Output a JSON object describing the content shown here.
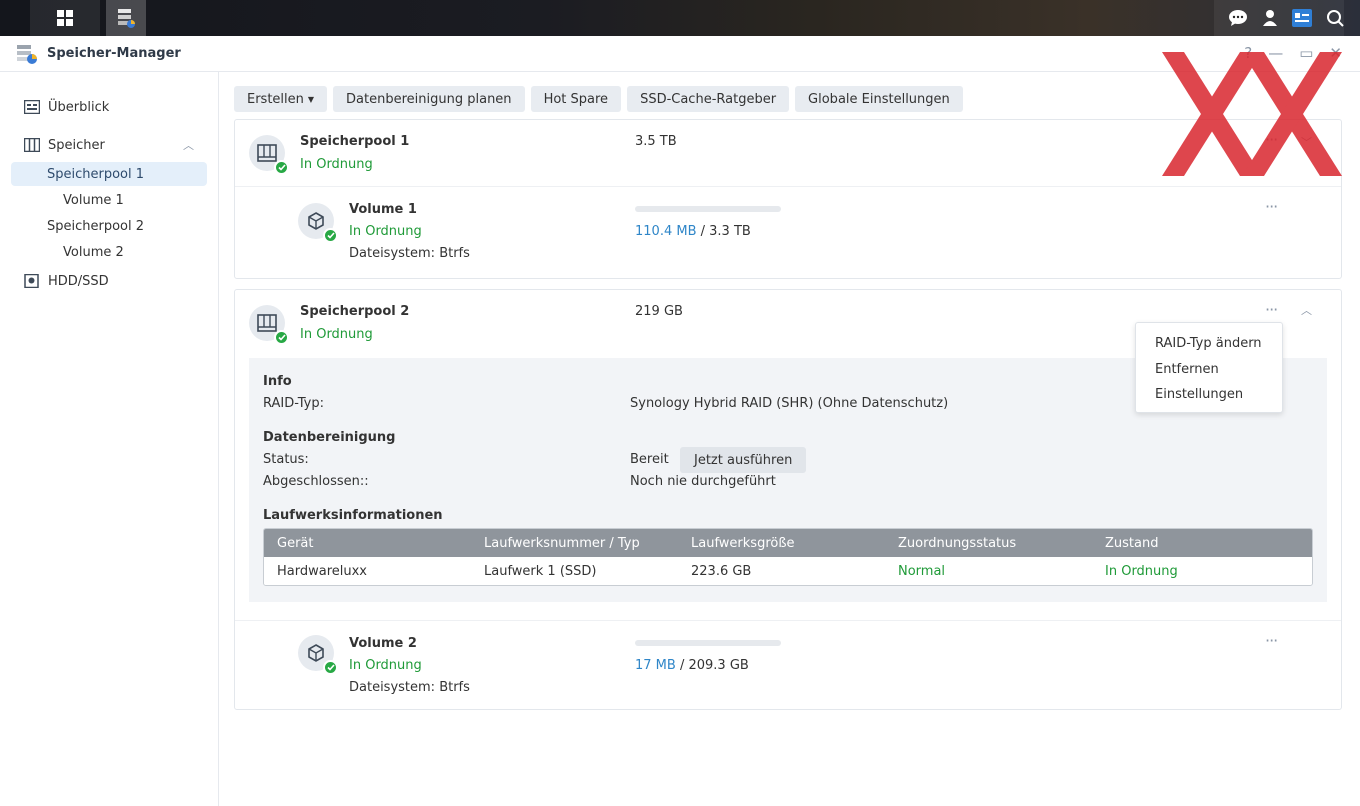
{
  "taskbar": {
    "grid_icon": "grid-icon",
    "app_icon": "storage-manager-icon",
    "right_icons": [
      "chat-icon",
      "user-icon",
      "widget-icon",
      "search-icon"
    ]
  },
  "window": {
    "title": "Speicher-Manager",
    "controls": {
      "help": "?",
      "minimize": "—",
      "restore": "▭",
      "close": "✕"
    }
  },
  "sidebar": {
    "overview": "Überblick",
    "storage": "Speicher",
    "pool1": "Speicherpool 1",
    "pool1_vol": "Volume 1",
    "pool2": "Speicherpool 2",
    "pool2_vol": "Volume 2",
    "hdd": "HDD/SSD"
  },
  "toolbar": {
    "create": "Erstellen",
    "scrub": "Datenbereinigung planen",
    "hotspare": "Hot Spare",
    "ssd": "SSD-Cache-Ratgeber",
    "global": "Globale Einstellungen"
  },
  "pool1": {
    "name": "Speicherpool 1",
    "status": "In Ordnung",
    "size": "3.5 TB",
    "volume": {
      "name": "Volume 1",
      "status": "In Ordnung",
      "fs": "Dateisystem: Btrfs",
      "used": "110.4 MB",
      "sep": " / ",
      "total": "3.3 TB",
      "usage_fraction": 0.0
    }
  },
  "pool2": {
    "name": "Speicherpool 2",
    "status": "In Ordnung",
    "size": "219 GB",
    "info": {
      "heading": "Info",
      "raid_label": "RAID-Typ:",
      "raid_value": "Synology Hybrid RAID (SHR) (Ohne Datenschutz)"
    },
    "scrub": {
      "heading": "Datenbereinigung",
      "status_label": "Status:",
      "status_value": "Bereit",
      "run_button": "Jetzt ausführen",
      "done_label": "Abgeschlossen::",
      "done_value": "Noch nie durchgeführt"
    },
    "drives": {
      "heading": "Laufwerksinformationen",
      "columns": [
        "Gerät",
        "Laufwerksnummer / Typ",
        "Laufwerksgröße",
        "Zuordnungsstatus",
        "Zustand"
      ],
      "rows": [
        [
          "Hardwareluxx",
          "Laufwerk 1 (SSD)",
          "223.6 GB",
          "Normal",
          "In Ordnung"
        ]
      ]
    },
    "volume": {
      "name": "Volume 2",
      "status": "In Ordnung",
      "fs": "Dateisystem: Btrfs",
      "used": "17 MB",
      "sep": " / ",
      "total": "209.3 GB",
      "usage_fraction": 0.0
    }
  },
  "context_menu": {
    "items": [
      "RAID-Typ ändern",
      "Entfernen",
      "Einstellungen"
    ]
  },
  "colors": {
    "ok_green": "#1f9a38",
    "link_blue": "#2f86c8",
    "watermark_red": "#d9262e"
  }
}
